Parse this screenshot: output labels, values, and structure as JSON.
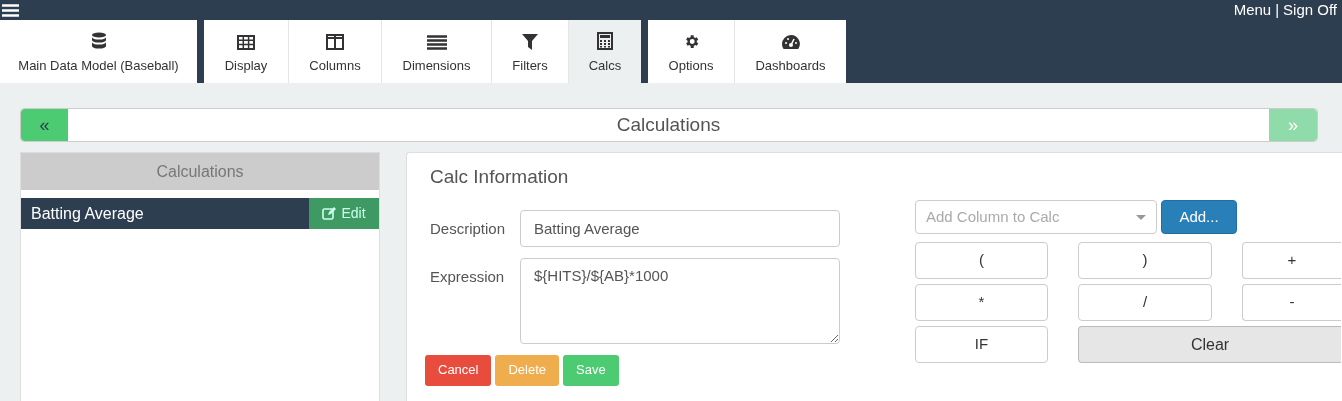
{
  "top_bar": {
    "links": [
      "Menu",
      "Sign Off"
    ],
    "separator": "|"
  },
  "tab_groups": [
    {
      "tabs": [
        {
          "label": "Main Data Model (Baseball)",
          "kind": "database",
          "selected": false
        }
      ]
    },
    {
      "tabs": [
        {
          "label": "Display",
          "kind": "grid",
          "selected": false
        },
        {
          "label": "Columns",
          "kind": "columns",
          "selected": false
        },
        {
          "label": "Dimensions",
          "kind": "list",
          "selected": false
        },
        {
          "label": "Filters",
          "kind": "filter",
          "selected": false
        },
        {
          "label": "Calcs",
          "kind": "calculator",
          "selected": true
        }
      ]
    },
    {
      "tabs": [
        {
          "label": "Options",
          "kind": "gear",
          "selected": false
        },
        {
          "label": "Dashboards",
          "kind": "gauge",
          "selected": false
        }
      ]
    }
  ],
  "nav": {
    "prev": "«",
    "title": "Calculations",
    "next": "»"
  },
  "calc_list": {
    "title": "Calculations",
    "items": [
      {
        "label": "Batting Average",
        "selected": true,
        "action": "Edit"
      }
    ]
  },
  "calc_info": {
    "title": "Calc Information",
    "fields": [
      {
        "label": "Description",
        "kind": "input",
        "value": "Batting Average"
      },
      {
        "label": "Expression",
        "kind": "textarea",
        "value": "${HITS}/${AB}*1000"
      }
    ],
    "actions": [
      {
        "label": "Cancel",
        "kind": "danger"
      },
      {
        "label": "Delete",
        "kind": "warning"
      },
      {
        "label": "Save",
        "kind": "success"
      }
    ],
    "column_select": {
      "placeholder": "Add Column to Calc"
    },
    "add_button": "Add...",
    "keys": [
      {
        "label": "(",
        "kind": "key"
      },
      {
        "label": ")",
        "kind": "key"
      },
      {
        "label": "+",
        "kind": "key"
      },
      {
        "label": "*",
        "kind": "key"
      },
      {
        "label": "/",
        "kind": "key"
      },
      {
        "label": "-",
        "kind": "key"
      },
      {
        "label": "IF",
        "kind": "key"
      },
      {
        "label": "Clear",
        "kind": "wide"
      }
    ]
  }
}
